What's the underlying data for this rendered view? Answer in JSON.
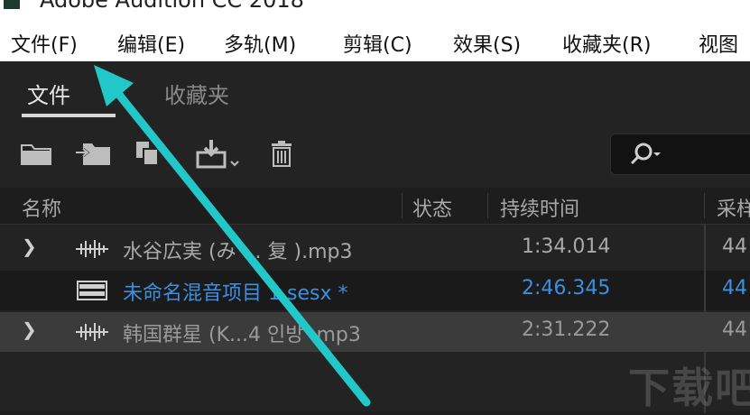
{
  "window": {
    "title": "Adobe Audition CC 2018"
  },
  "menu": {
    "items": [
      "文件(F)",
      "编辑(E)",
      "多轨(M)",
      "剪辑(C)",
      "效果(S)",
      "收藏夹(R)",
      "视图"
    ]
  },
  "panel": {
    "tabs": [
      {
        "label": "文件",
        "active": true
      },
      {
        "label": "收藏夹",
        "active": false
      }
    ],
    "toolbar": {
      "icons": [
        "open-folder-icon",
        "import-icon",
        "new-file-icon",
        "save-download-icon",
        "delete-icon"
      ]
    },
    "search": {
      "placeholder": ""
    },
    "columns": [
      "名称",
      "状态",
      "持续时间",
      "采样率"
    ],
    "rows": [
      {
        "name": "水谷広実 (み ... 复 ).mp3",
        "duration": "1:34.014",
        "rate": "44",
        "type": "audio",
        "expandable": true,
        "selected": false
      },
      {
        "name": "未命名混音项目 1.sesx *",
        "duration": "2:46.345",
        "rate": "44",
        "type": "session",
        "expandable": false,
        "selected": true
      },
      {
        "name": "韩国群星 (K...4 인방 .mp3",
        "duration": "2:31.222",
        "rate": "44",
        "type": "audio",
        "expandable": true,
        "selected": false
      }
    ]
  },
  "colors": {
    "accent_blue": "#3d8fe0",
    "arrow": "#22c7c7",
    "row_highlight": "#3b3b3b",
    "row_selected": "#1a1a1a"
  },
  "watermark": {
    "text": "下载吧"
  }
}
